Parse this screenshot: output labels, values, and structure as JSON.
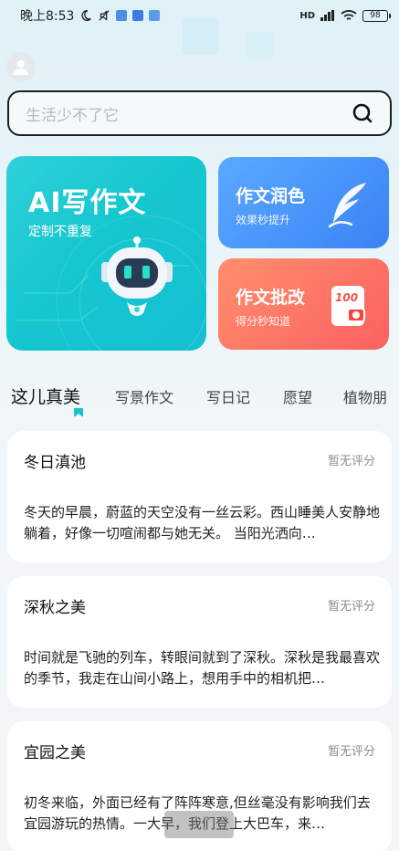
{
  "status_bar": {
    "time": "晚上8:53",
    "network": "HD",
    "battery": "98"
  },
  "search": {
    "placeholder": "生活少不了它"
  },
  "feature_cards": {
    "ai": {
      "title": "AI写作文",
      "subtitle": "定制不重复"
    },
    "polish": {
      "title": "作文润色",
      "subtitle": "效果秒提升"
    },
    "correct": {
      "title": "作文批改",
      "subtitle": "得分秒知道",
      "badge": "100"
    }
  },
  "tabs": [
    "这儿真美",
    "写景作文",
    "写日记",
    "愿望",
    "植物朋"
  ],
  "articles": [
    {
      "title": "冬日滇池",
      "rating": "暂无评分",
      "excerpt": "冬天的早晨，蔚蓝的天空没有一丝云彩。西山睡美人安静地躺着，好像一切喧闹都与她无关。 当阳光洒向…"
    },
    {
      "title": "深秋之美",
      "rating": "暂无评分",
      "excerpt": "时间就是飞驰的列车，转眼间就到了深秋。深秋是我最喜欢的季节，我走在山间小路上，想用手中的相机把…"
    },
    {
      "title": "宜园之美",
      "rating": "暂无评分",
      "excerpt": "初冬来临，外面已经有了阵阵寒意,但丝毫没有影响我们去宜园游玩的热情。一大早，我们登上大巴车，来…"
    }
  ],
  "colors": {
    "ai_card": "#15c7cf",
    "polish_card": "#3b83f6",
    "correct_card": "#fb6161",
    "tab_indicator": "#19c4c9"
  }
}
